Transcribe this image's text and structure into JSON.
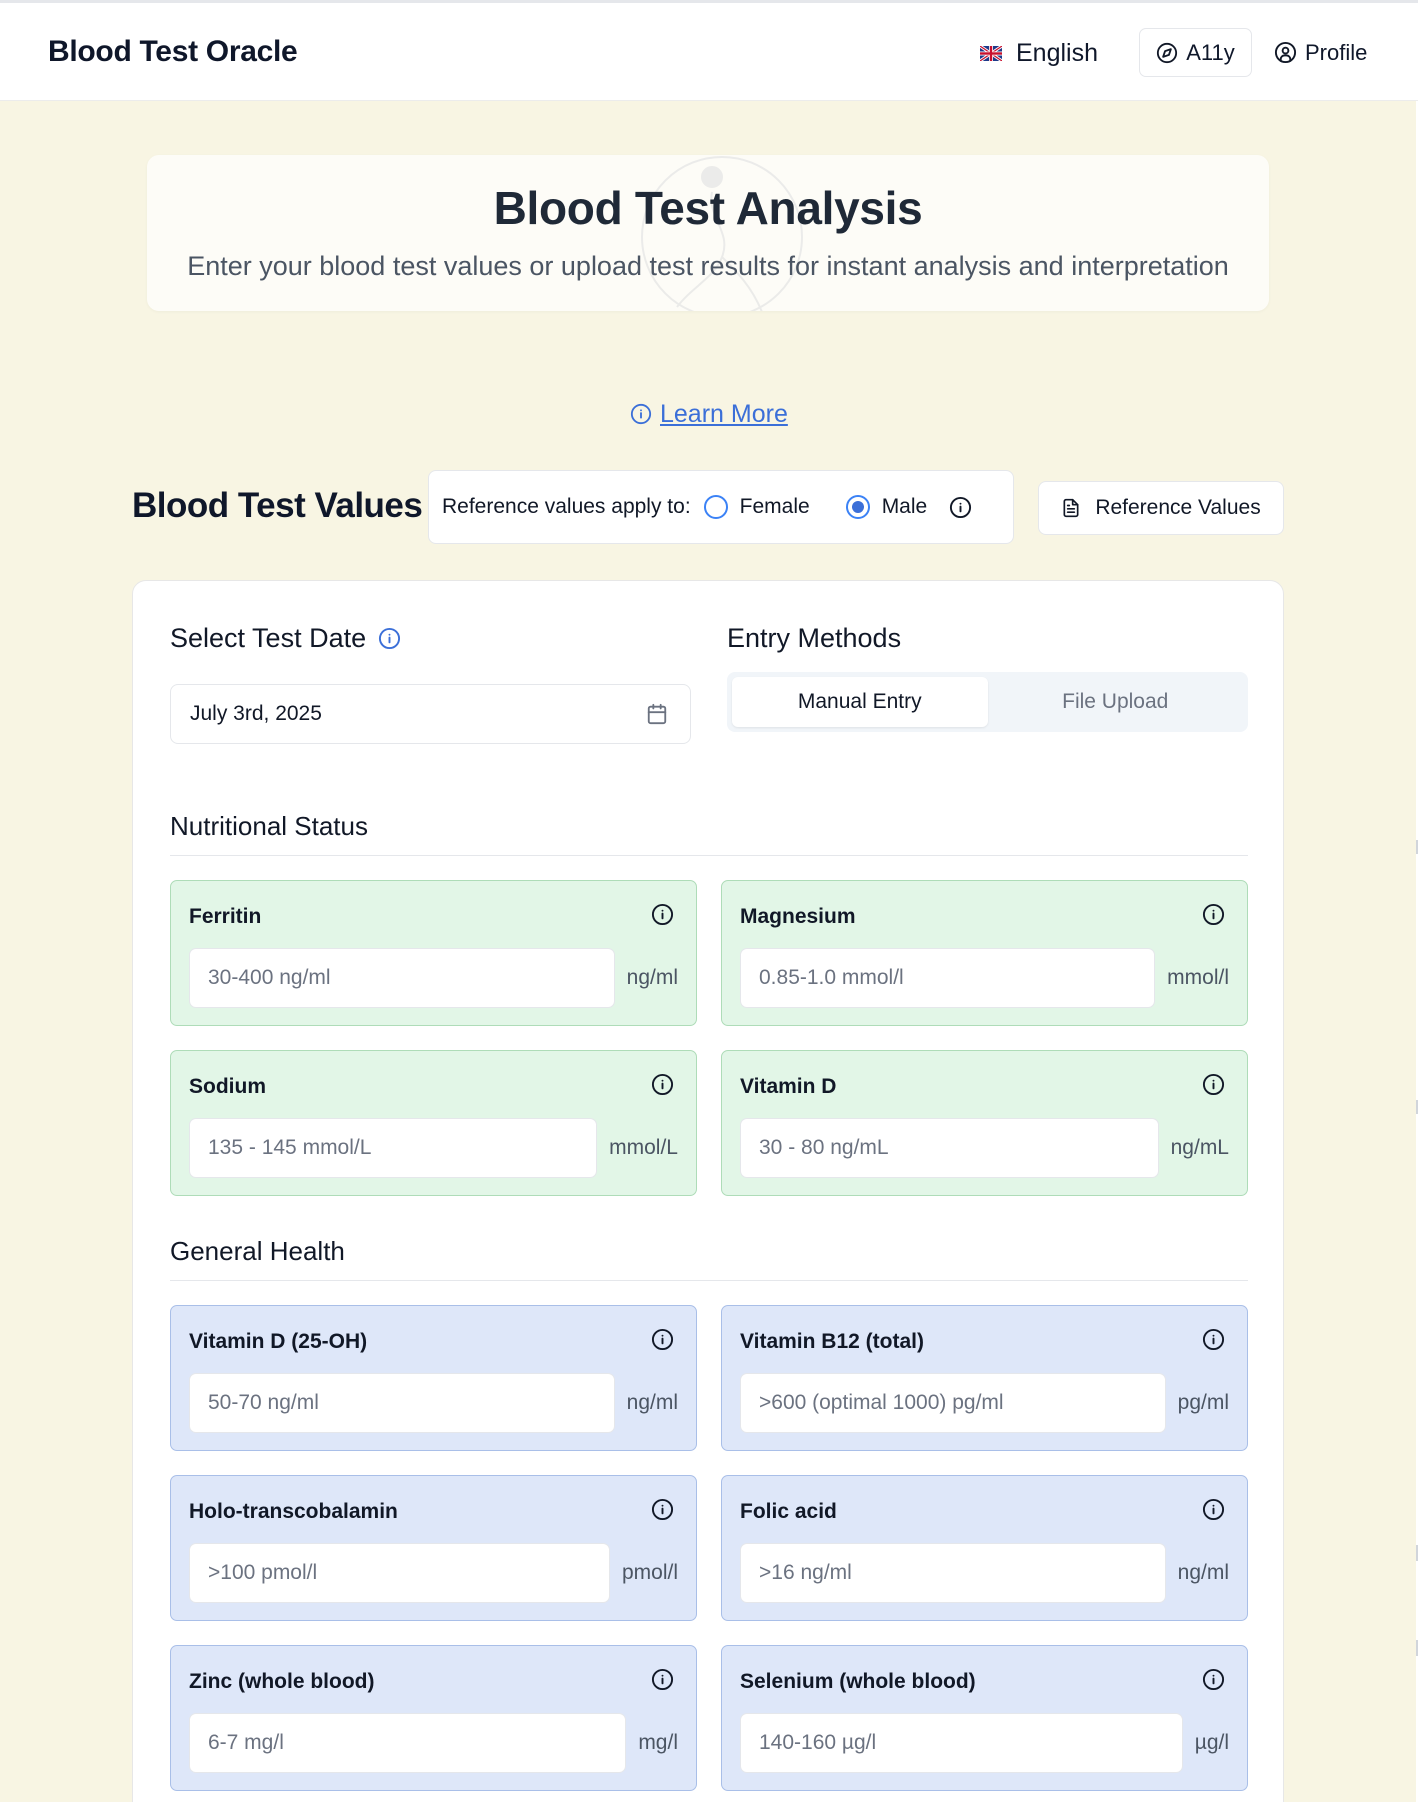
{
  "header": {
    "brand": "Blood Test Oracle",
    "language": "English",
    "language_flag_icon": "uk-flag-icon",
    "a11y_label": "A11y",
    "a11y_icon": "compass-icon",
    "profile_label": "Profile",
    "profile_icon": "user-circle-icon"
  },
  "hero": {
    "title": "Blood Test Analysis",
    "subtitle": "Enter your blood test values or upload test results for instant analysis and interpretation"
  },
  "learn_more": "Learn More",
  "values_section": {
    "title": "Blood Test Values",
    "reference_prompt": "Reference values apply to:",
    "options": [
      {
        "label": "Female",
        "selected": false
      },
      {
        "label": "Male",
        "selected": true
      }
    ],
    "reference_button": "Reference Values"
  },
  "date": {
    "title": "Select Test Date",
    "value": "July 3rd, 2025"
  },
  "entry": {
    "title": "Entry Methods",
    "tabs": [
      {
        "label": "Manual Entry",
        "active": true
      },
      {
        "label": "File Upload",
        "active": false
      }
    ]
  },
  "groups": [
    {
      "title": "Nutritional Status",
      "accent": "#e2f6e7",
      "items": [
        {
          "name": "Ferritin",
          "placeholder": "30-400 ng/ml",
          "unit": "ng/ml"
        },
        {
          "name": "Magnesium",
          "placeholder": "0.85-1.0 mmol/l",
          "unit": "mmol/l"
        },
        {
          "name": "Sodium",
          "placeholder": "135 - 145 mmol/L",
          "unit": "mmol/L"
        },
        {
          "name": "Vitamin D",
          "placeholder": "30 - 80 ng/mL",
          "unit": "ng/mL"
        }
      ]
    },
    {
      "title": "General Health",
      "accent": "#dee7f9",
      "items": [
        {
          "name": "Vitamin D (25-OH)",
          "placeholder": "50-70 ng/ml",
          "unit": "ng/ml"
        },
        {
          "name": "Vitamin B12 (total)",
          "placeholder": ">600 (optimal 1000) pg/ml",
          "unit": "pg/ml"
        },
        {
          "name": "Holo-transcobalamin",
          "placeholder": ">100 pmol/l",
          "unit": "pmol/l"
        },
        {
          "name": "Folic acid",
          "placeholder": ">16 ng/ml",
          "unit": "ng/ml"
        },
        {
          "name": "Zinc (whole blood)",
          "placeholder": "6-7 mg/l",
          "unit": "mg/l"
        },
        {
          "name": "Selenium (whole blood)",
          "placeholder": "140-160 µg/l",
          "unit": "µg/l"
        }
      ]
    }
  ]
}
